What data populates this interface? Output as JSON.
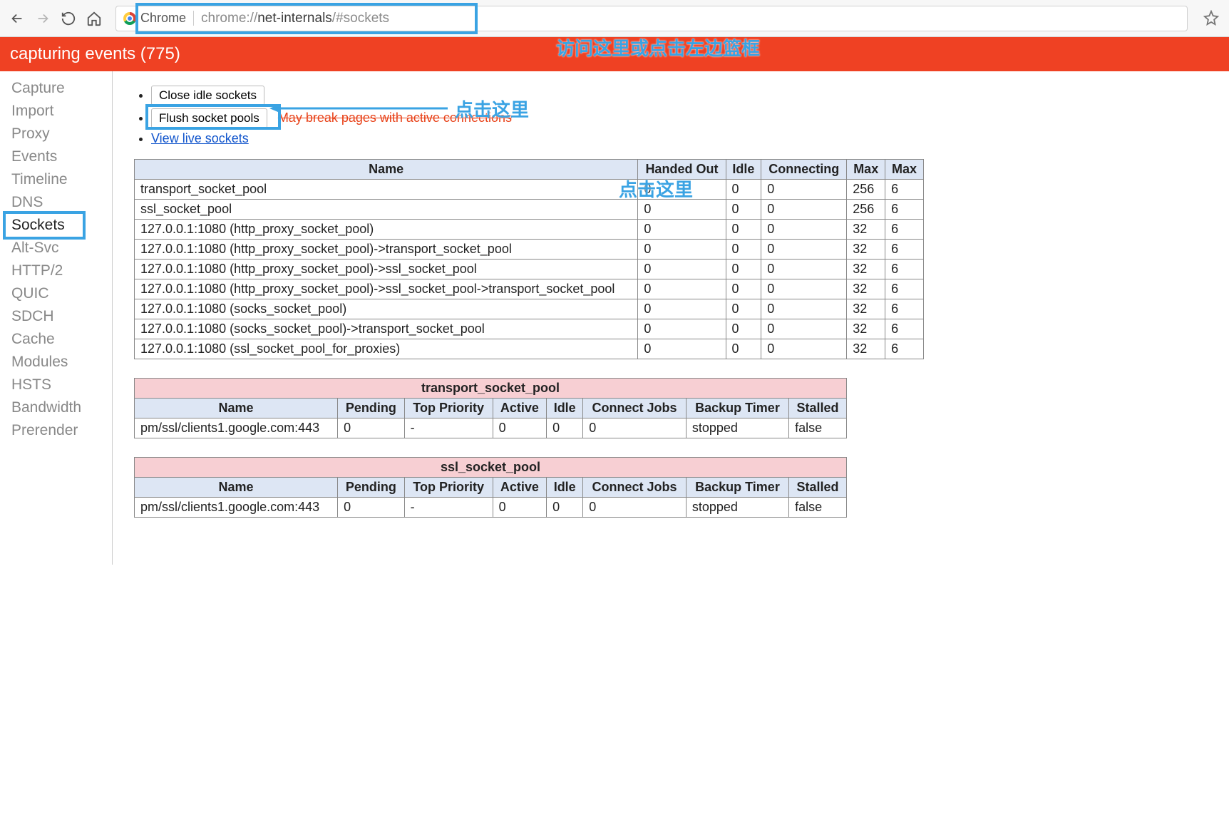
{
  "toolbar": {
    "chrome_label": "Chrome",
    "url_gray_prefix": "chrome://",
    "url_dark": "net-internals",
    "url_gray_suffix": "/#sockets"
  },
  "banner": "capturing events (775)",
  "sidebar": {
    "items": [
      {
        "label": "Capture"
      },
      {
        "label": "Import"
      },
      {
        "label": "Proxy"
      },
      {
        "label": "Events"
      },
      {
        "label": "Timeline"
      },
      {
        "label": "DNS"
      },
      {
        "label": "Sockets",
        "active": true
      },
      {
        "label": "Alt-Svc"
      },
      {
        "label": "HTTP/2"
      },
      {
        "label": "QUIC"
      },
      {
        "label": "SDCH"
      },
      {
        "label": "Cache"
      },
      {
        "label": "Modules"
      },
      {
        "label": "HSTS"
      },
      {
        "label": "Bandwidth"
      },
      {
        "label": "Prerender"
      }
    ]
  },
  "actions": {
    "close_idle": "Close idle sockets",
    "flush": "Flush socket pools",
    "flush_warn": "May break pages with active connections",
    "live": "View live sockets"
  },
  "pool_table": {
    "headers": [
      "Name",
      "Handed Out",
      "Idle",
      "Connecting",
      "Max",
      "Max"
    ],
    "rows": [
      [
        "transport_socket_pool",
        "0",
        "0",
        "0",
        "256",
        "6"
      ],
      [
        "ssl_socket_pool",
        "0",
        "0",
        "0",
        "256",
        "6"
      ],
      [
        "127.0.0.1:1080 (http_proxy_socket_pool)",
        "0",
        "0",
        "0",
        "32",
        "6"
      ],
      [
        "127.0.0.1:1080 (http_proxy_socket_pool)->transport_socket_pool",
        "0",
        "0",
        "0",
        "32",
        "6"
      ],
      [
        "127.0.0.1:1080 (http_proxy_socket_pool)->ssl_socket_pool",
        "0",
        "0",
        "0",
        "32",
        "6"
      ],
      [
        "127.0.0.1:1080 (http_proxy_socket_pool)->ssl_socket_pool->transport_socket_pool",
        "0",
        "0",
        "0",
        "32",
        "6"
      ],
      [
        "127.0.0.1:1080 (socks_socket_pool)",
        "0",
        "0",
        "0",
        "32",
        "6"
      ],
      [
        "127.0.0.1:1080 (socks_socket_pool)->transport_socket_pool",
        "0",
        "0",
        "0",
        "32",
        "6"
      ],
      [
        "127.0.0.1:1080 (ssl_socket_pool_for_proxies)",
        "0",
        "0",
        "0",
        "32",
        "6"
      ]
    ]
  },
  "detail_tables": [
    {
      "title": "transport_socket_pool",
      "headers": [
        "Name",
        "Pending",
        "Top Priority",
        "Active",
        "Idle",
        "Connect Jobs",
        "Backup Timer",
        "Stalled"
      ],
      "rows": [
        [
          "pm/ssl/clients1.google.com:443",
          "0",
          "-",
          "0",
          "0",
          "0",
          "stopped",
          "false"
        ]
      ]
    },
    {
      "title": "ssl_socket_pool",
      "headers": [
        "Name",
        "Pending",
        "Top Priority",
        "Active",
        "Idle",
        "Connect Jobs",
        "Backup Timer",
        "Stalled"
      ],
      "rows": [
        [
          "pm/ssl/clients1.google.com:443",
          "0",
          "-",
          "0",
          "0",
          "0",
          "stopped",
          "false"
        ]
      ]
    }
  ],
  "annotations": {
    "top": "访问这里或点击左边篮框",
    "flush": "点击这里",
    "row": "点击这里"
  }
}
